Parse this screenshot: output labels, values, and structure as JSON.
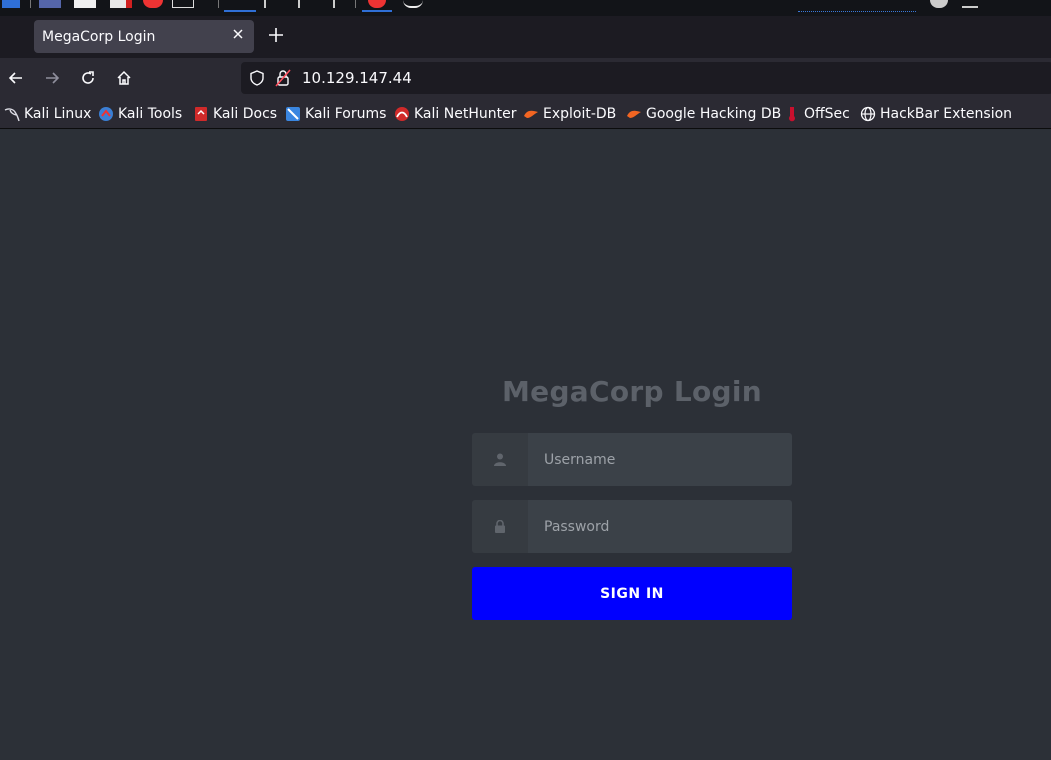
{
  "colors": {
    "page_background": "#2c3037",
    "button": "#0000ff",
    "title": "#5c6169",
    "input_background": "#3b4148",
    "icon_box_background": "#363b41"
  },
  "browser": {
    "tab": {
      "title": "MegaCorp Login",
      "close_icon": "close-icon"
    },
    "new_tab_icon": "plus-icon",
    "nav": {
      "back_icon": "arrow-left-icon",
      "forward_icon": "arrow-right-icon",
      "reload_icon": "reload-icon",
      "home_icon": "home-icon"
    },
    "url": "10.129.147.44",
    "bookmarks": [
      {
        "label": "Kali Linux",
        "icon": "kali-dragon-icon"
      },
      {
        "label": "Kali Tools",
        "icon": "kali-tools-icon"
      },
      {
        "label": "Kali Docs",
        "icon": "kali-docs-icon"
      },
      {
        "label": "Kali Forums",
        "icon": "kali-forums-icon"
      },
      {
        "label": "Kali NetHunter",
        "icon": "nethunter-icon"
      },
      {
        "label": "Exploit-DB",
        "icon": "exploit-db-icon"
      },
      {
        "label": "Google Hacking DB",
        "icon": "ghdb-icon"
      },
      {
        "label": "OffSec",
        "icon": "offsec-icon"
      },
      {
        "label": "HackBar Extension",
        "icon": "globe-icon"
      }
    ]
  },
  "login": {
    "title": "MegaCorp Login",
    "username_placeholder": "Username",
    "password_placeholder": "Password",
    "username_icon": "user-icon",
    "password_icon": "lock-icon",
    "submit_label": "SIGN IN"
  }
}
